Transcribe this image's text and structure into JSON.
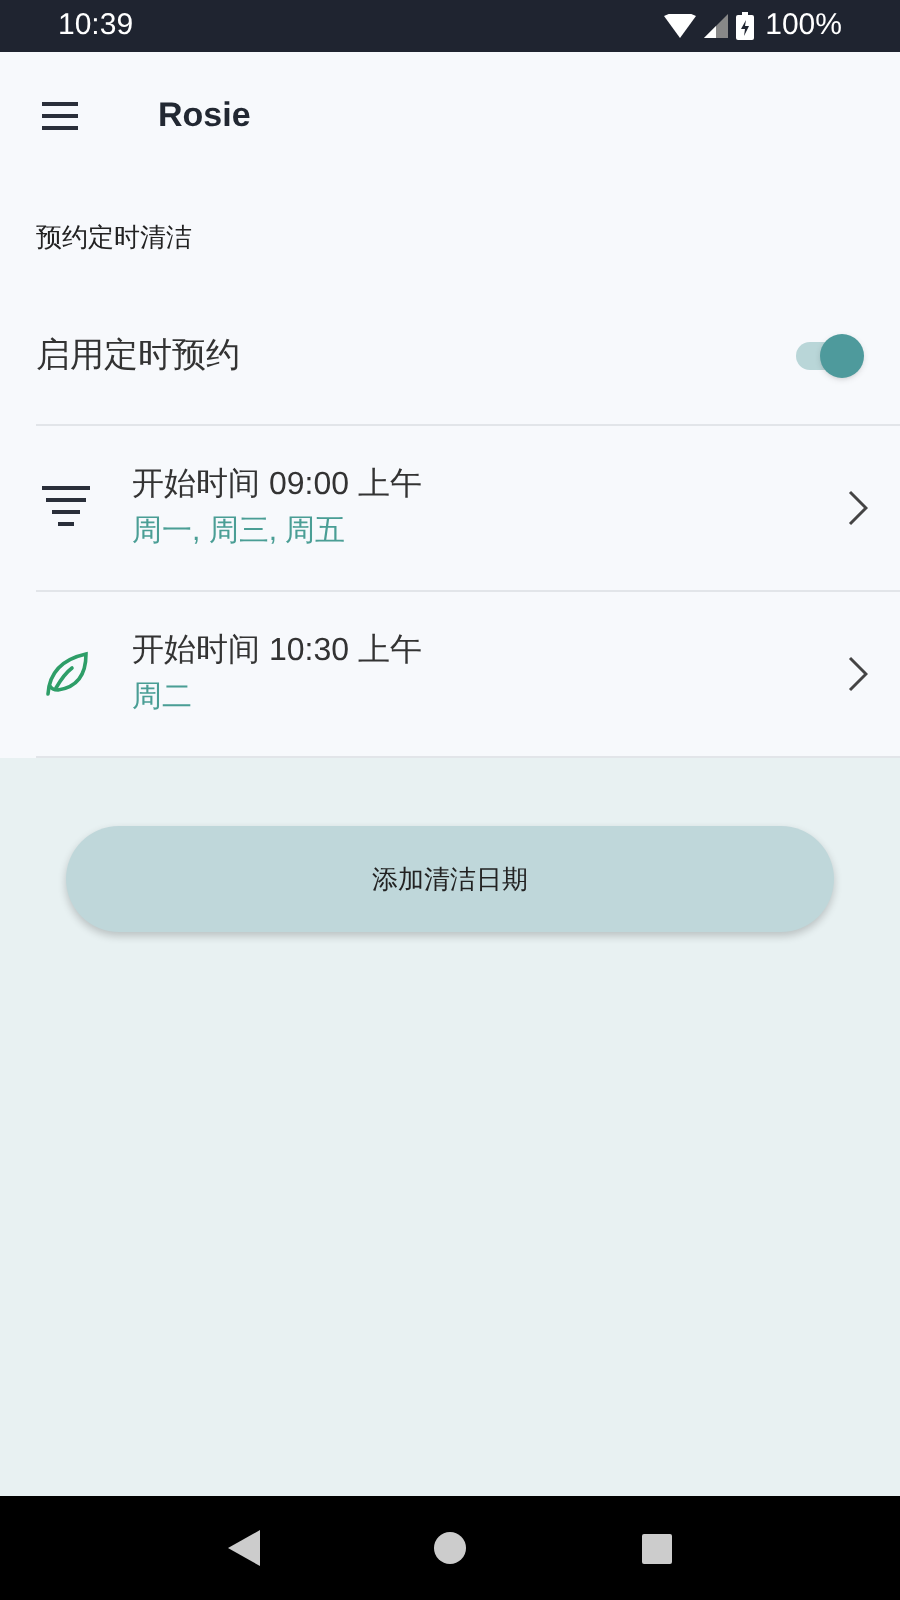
{
  "status_bar": {
    "time": "10:39",
    "battery": "100%"
  },
  "app_bar": {
    "title": "Rosie"
  },
  "section_title": "预约定时清洁",
  "schedule_toggle": {
    "label": "启用定时预约",
    "on": true
  },
  "schedules": [
    {
      "kind": "lines",
      "time": "开始时间 09:00 上午",
      "days": "周一, 周三, 周五"
    },
    {
      "kind": "leaf",
      "time": "开始时间 10:30 上午",
      "days": "周二"
    }
  ],
  "add_button": "添加清洁日期"
}
